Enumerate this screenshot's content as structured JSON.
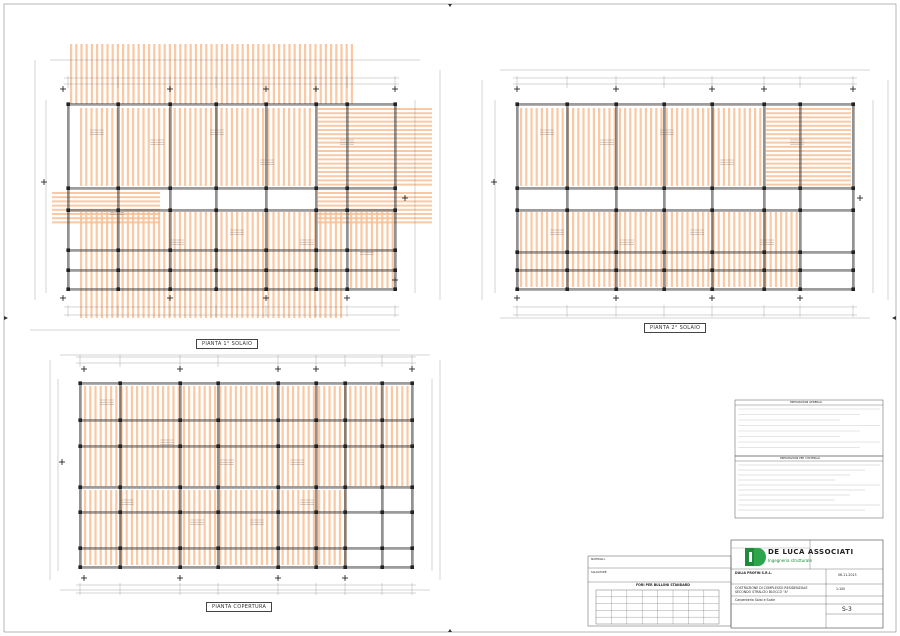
{
  "plans": {
    "plan1_title": "PIANTA 1° SOLAIO",
    "plan2_title": "PIANTA 2° SOLAIO",
    "plan3_title": "PIANTA COPERTURA"
  },
  "notes": {
    "general_title": "PRESCRIZIONI GENERALI",
    "materials_title": "PRESCRIZIONI PER I MATERIALI",
    "bolts_title": "FORI PER BULLONI STANDARD",
    "materials_label": "MATERIALI:",
    "welds_label": "SALDATURE:"
  },
  "titleblock": {
    "company": "DE LUCA ASSOCIATI",
    "company_sub": "Ingegneria strutturale",
    "client": "DULIA PROFIN S.R.L.",
    "project_line1": "COSTRUZIONE DI COMPLESSO RESIDENZIALE",
    "project_line2": "SECONDO STRALCIO BLOCCO \"A\"",
    "drawing_desc": "Carpenteria Solai e Scale",
    "scale": "1:100",
    "sheet_no": "S-3",
    "date": "06-11-2013"
  },
  "colors": {
    "joist": "#f7bf94",
    "line": "#3a3a3a",
    "dim": "#777777",
    "logo_green": "#1f8a3a"
  }
}
